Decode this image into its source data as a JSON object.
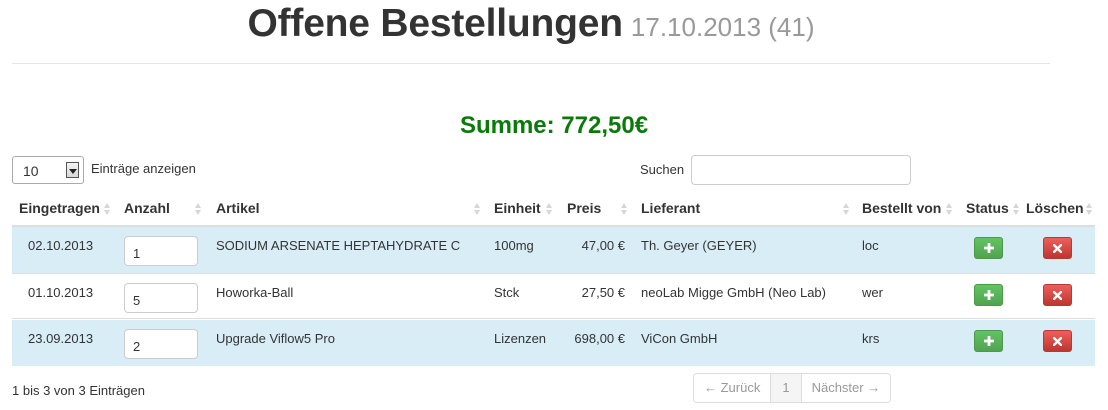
{
  "header": {
    "title": "Offene Bestellungen",
    "subtitle": "17.10.2013 (41)"
  },
  "summary": {
    "summe": "Summe: 772,50€"
  },
  "controls": {
    "length_value": "10",
    "length_label": "Einträge anzeigen",
    "search_label": "Suchen",
    "search_value": ""
  },
  "table": {
    "columns": [
      "Eingetragen",
      "Anzahl",
      "Artikel",
      "Einheit",
      "Preis",
      "Lieferant",
      "Bestellt von",
      "Status",
      "Löschen"
    ],
    "rows": [
      {
        "date": "02.10.2013",
        "qty": "1",
        "article": "SODIUM ARSENATE HEPTAHYDRATE C",
        "unit": "100mg",
        "price": "47,00 €",
        "supplier": "Th. Geyer (GEYER)",
        "ordered_by": "loc"
      },
      {
        "date": "01.10.2013",
        "qty": "5",
        "article": "Howorka-Ball",
        "unit": "Stck",
        "price": "27,50 €",
        "supplier": "neoLab Migge GmbH (Neo Lab)",
        "ordered_by": "wer"
      },
      {
        "date": "23.09.2013",
        "qty": "2",
        "article": "Upgrade Viflow5 Pro",
        "unit": "Lizenzen",
        "price": "698,00 €",
        "supplier": "ViCon GmbH",
        "ordered_by": "krs"
      }
    ],
    "status_icon": "plus-icon",
    "delete_icon": "x-icon"
  },
  "footer": {
    "info": "1 bis 3 von 3 Einträgen",
    "prev": "← Zurück",
    "page": "1",
    "next": "Nächster →"
  },
  "colors": {
    "summe": "#0a7a0a",
    "row_highlight": "#d9edf7",
    "status_button": "#51a351",
    "delete_button": "#bd362f"
  }
}
